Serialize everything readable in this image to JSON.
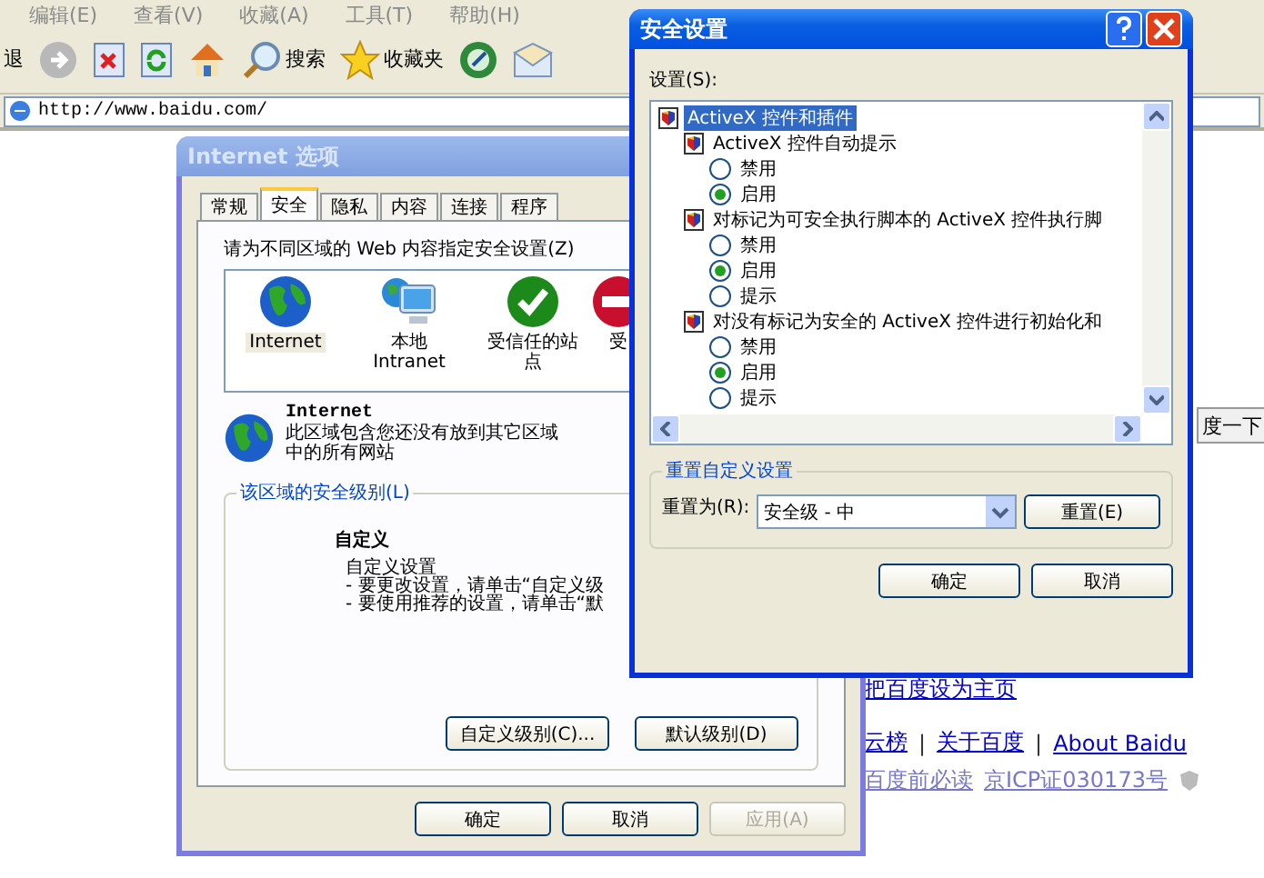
{
  "menu_bar": [
    "编辑(E)",
    "查看(V)",
    "收藏(A)",
    "工具(T)",
    "帮助(H)"
  ],
  "toolbar": {
    "back": "退",
    "search": "搜索",
    "favorites": "收藏夹"
  },
  "address": "http://www.baidu.com/",
  "page": {
    "search_button": "度一下",
    "home_link": "把百度设为主页",
    "links": [
      "云榜",
      "关于百度",
      "About Baidu"
    ],
    "separators": [
      "|",
      "|"
    ],
    "footer_links": [
      "百度前必读",
      "京ICP证030173号"
    ]
  },
  "internet_options": {
    "title": "Internet 选项",
    "active": false,
    "tabs": [
      {
        "label": "常规",
        "selected": false
      },
      {
        "label": "安全",
        "selected": true
      },
      {
        "label": "隐私",
        "selected": false
      },
      {
        "label": "内容",
        "selected": false
      },
      {
        "label": "连接",
        "selected": false
      },
      {
        "label": "程序",
        "selected": false
      }
    ],
    "prompt": "请为不同区域的 Web 内容指定安全设置(Z)",
    "zones": [
      {
        "label": "Internet",
        "kind": "globe",
        "selected": true
      },
      {
        "label": "本地 Intranet",
        "kind": "computer",
        "selected": false
      },
      {
        "label": "受信任的站点",
        "kind": "trusted",
        "selected": false
      },
      {
        "label": "受",
        "kind": "restricted",
        "selected": false
      }
    ],
    "zone_name": "Internet",
    "zone_description": "此区域包含您还没有放到其它区域中的所有网站",
    "level_group": "该区域的安全级别(L)",
    "level_title": "自定义",
    "level_lines": [
      "自定义设置",
      "- 要更改设置，请单击“自定义级",
      "- 要使用推荐的设置，请单击“默"
    ],
    "level_buttons": [
      "自定义级别(C)...",
      "默认级别(D)"
    ],
    "buttons": [
      {
        "label": "确定",
        "disabled": false
      },
      {
        "label": "取消",
        "disabled": false
      },
      {
        "label": "应用(A)",
        "disabled": true
      }
    ]
  },
  "security_settings": {
    "title": "安全设置",
    "active": true,
    "list_label": "设置(S):",
    "tree": [
      {
        "label": "ActiveX 控件和插件",
        "selected": true,
        "children": [
          {
            "label": "ActiveX 控件自动提示",
            "selected": false,
            "children": [
              {
                "label": "禁用",
                "selected": false
              },
              {
                "label": "启用",
                "selected": true
              }
            ]
          },
          {
            "label": "对标记为可安全执行脚本的 ActiveX 控件执行脚",
            "selected": false,
            "children": [
              {
                "label": "禁用",
                "selected": false
              },
              {
                "label": "启用",
                "selected": true
              },
              {
                "label": "提示",
                "selected": false
              }
            ]
          },
          {
            "label": "对没有标记为安全的 ActiveX 控件进行初始化和",
            "selected": false,
            "children": [
              {
                "label": "禁用",
                "selected": false
              },
              {
                "label": "启用",
                "selected": true
              },
              {
                "label": "提示",
                "selected": false
              }
            ]
          }
        ]
      }
    ],
    "reset_group": "重置自定义设置",
    "reset_label": "重置为(R):",
    "reset_value": "安全级 - 中",
    "reset_button": "重置(E)",
    "buttons": [
      "确定",
      "取消"
    ]
  }
}
